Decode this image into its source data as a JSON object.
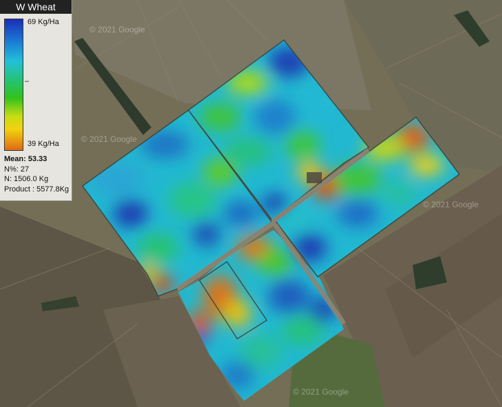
{
  "legend": {
    "title": "W Wheat",
    "max_label": "69 Kg/Ha",
    "mid_tick": "–",
    "min_label": "39 Kg/Ha"
  },
  "stats": {
    "mean": "Mean: 53.33",
    "n_percent": "N%: 27",
    "n": "N: 1506.0 Kg",
    "product": "Product : 5577.8Kg"
  },
  "watermarks": [
    "© 2021 Google",
    "© 2021 Google",
    "© 2021 Google",
    "© 2021 Google"
  ],
  "colors": {
    "high": "#1a2fb8",
    "mid": "#31c21c",
    "low": "#e06a14",
    "background": "#6f6a55"
  }
}
